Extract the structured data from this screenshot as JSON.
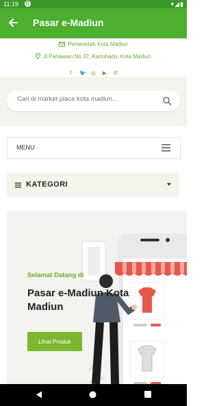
{
  "status_bar": {
    "time": "11:19",
    "g_icon": "G",
    "right_icons": "▾◢▮"
  },
  "app_bar": {
    "title": "Pasar e-Madiun",
    "back_icon": "arrow-back-icon"
  },
  "contact": {
    "org": "Pemerintah Kota Madiun",
    "address": "Jl.Pahlawan No.37, Kartoharjo, Kota Madiun",
    "social": [
      "facebook-icon",
      "twitter-icon",
      "instagram-icon",
      "youtube-icon",
      "whatsapp-icon"
    ]
  },
  "search": {
    "placeholder": "Cari di market place kota madiun..."
  },
  "menu": {
    "label": "MENU"
  },
  "kategori": {
    "label": "KATEGORI"
  },
  "hero": {
    "welcome": "Selamat Datang di",
    "title": "Pasar e-Madiun Kota Madiun",
    "button": "Lihat Produk"
  },
  "colors": {
    "green": "#4caf2f",
    "accent": "#7cb82f",
    "text_green": "#6aab2a",
    "awning_red": "#e8574c"
  }
}
